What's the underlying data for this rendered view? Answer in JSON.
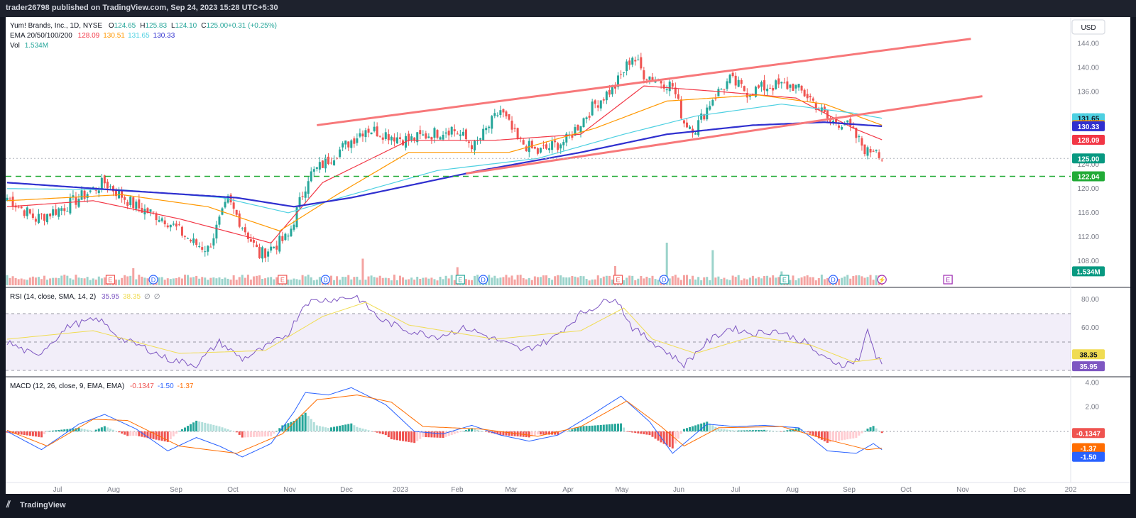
{
  "header": {
    "published": "trader26798 published on TradingView.com, Sep 24, 2023 15:28 UTC+5:30"
  },
  "footer": {
    "brand": "TradingView"
  },
  "colors": {
    "up": "#26a69a",
    "down": "#ef5350",
    "ema20": "#f23645",
    "ema50": "#ff9800",
    "ema100": "#4dd0e1",
    "ema200": "#2f2fcf",
    "trend": "#f7787a",
    "support": "#22ab37",
    "rsi": "#7e57c2",
    "rsi_ma": "#f0dc52",
    "macd": "#2962ff",
    "signal": "#ff6d00"
  },
  "currency_button": "USD",
  "legend": {
    "symbol": "Yum! Brands, Inc., 1D, NYSE",
    "ohlc": [
      {
        "key": "O",
        "value": "124.65"
      },
      {
        "key": "H",
        "value": "125.83"
      },
      {
        "key": "L",
        "value": "124.10"
      },
      {
        "key": "C",
        "value": "125.00"
      },
      {
        "key": "",
        "value": "+0.31 (+0.25%)"
      }
    ],
    "ema_label": "EMA 20/50/100/200",
    "ema_values": [
      "128.09",
      "130.51",
      "131.65",
      "130.33"
    ],
    "vol_label": "Vol",
    "vol_value": "1.534M",
    "rsi_label": "RSI (14, close, SMA, 14, 2)",
    "rsi_values": [
      "35.95",
      "38.35",
      "∅",
      "∅"
    ],
    "macd_label": "MACD (12, 26, close, 9, EMA, EMA)",
    "macd_values": [
      "-0.1347",
      "-1.50",
      "-1.37"
    ]
  },
  "chart_data": [
    {
      "type": "candlestick",
      "title": "Yum! Brands, Inc., 1D, NYSE",
      "ylim": [
        104,
        147
      ],
      "yticks": [
        "108.00",
        "112.00",
        "116.00",
        "120.00",
        "124.00",
        "128.00",
        "132.00",
        "136.00",
        "140.00",
        "144.00"
      ],
      "x_month_labels": [
        "Jul",
        "Aug",
        "Sep",
        "Oct",
        "Nov",
        "Dec",
        "2023",
        "Feb",
        "Mar",
        "Apr",
        "May",
        "Jun",
        "Jul",
        "Aug",
        "Sep",
        "Oct",
        "Nov",
        "Dec",
        "202"
      ],
      "close_anchors": [
        [
          0,
          118.5
        ],
        [
          10,
          115
        ],
        [
          20,
          117
        ],
        [
          34,
          121
        ],
        [
          45,
          117
        ],
        [
          55,
          115
        ],
        [
          65,
          111
        ],
        [
          70,
          110
        ],
        [
          77,
          118
        ],
        [
          88,
          109
        ],
        [
          98,
          112
        ],
        [
          105,
          122
        ],
        [
          115,
          126
        ],
        [
          125,
          130
        ],
        [
          140,
          128
        ],
        [
          155,
          130
        ],
        [
          163,
          127
        ],
        [
          172,
          133
        ],
        [
          178,
          128
        ],
        [
          185,
          126
        ],
        [
          195,
          128
        ],
        [
          205,
          134
        ],
        [
          212,
          137
        ],
        [
          218,
          142
        ],
        [
          222,
          139
        ],
        [
          232,
          137
        ],
        [
          236,
          131
        ],
        [
          240,
          130
        ],
        [
          246,
          135
        ],
        [
          252,
          138
        ],
        [
          258,
          136
        ],
        [
          266,
          137
        ],
        [
          274,
          137
        ],
        [
          280,
          135
        ],
        [
          287,
          131
        ],
        [
          292,
          131
        ],
        [
          300,
          126
        ],
        [
          303,
          127
        ],
        [
          305,
          125
        ]
      ],
      "ema_anchors": {
        "EMA 20": [
          [
            0,
            117
          ],
          [
            30,
            118
          ],
          [
            60,
            115
          ],
          [
            92,
            111
          ],
          [
            110,
            121
          ],
          [
            140,
            128
          ],
          [
            170,
            128
          ],
          [
            200,
            129
          ],
          [
            222,
            137
          ],
          [
            250,
            136
          ],
          [
            275,
            135
          ],
          [
            295,
            130
          ],
          [
            305,
            128.09
          ]
        ],
        "EMA 50": [
          [
            0,
            118
          ],
          [
            40,
            119
          ],
          [
            70,
            117
          ],
          [
            95,
            113
          ],
          [
            115,
            119
          ],
          [
            140,
            126
          ],
          [
            175,
            126
          ],
          [
            205,
            130
          ],
          [
            230,
            134.5
          ],
          [
            262,
            135.5
          ],
          [
            285,
            134
          ],
          [
            305,
            130.51
          ]
        ],
        "EMA 100": [
          [
            0,
            120
          ],
          [
            40,
            119.8
          ],
          [
            75,
            118.5
          ],
          [
            98,
            116
          ],
          [
            120,
            119
          ],
          [
            150,
            123
          ],
          [
            185,
            125
          ],
          [
            215,
            129
          ],
          [
            240,
            132
          ],
          [
            270,
            134
          ],
          [
            295,
            132.5
          ],
          [
            305,
            131.65
          ]
        ],
        "EMA 200": [
          [
            0,
            121
          ],
          [
            40,
            119.7
          ],
          [
            80,
            118.5
          ],
          [
            100,
            117
          ],
          [
            120,
            118.5
          ],
          [
            165,
            123
          ],
          [
            200,
            126
          ],
          [
            230,
            129
          ],
          [
            260,
            130.5
          ],
          [
            285,
            131
          ],
          [
            305,
            130.33
          ]
        ]
      },
      "trendlines": [
        {
          "from": [
            108,
            130.5
          ],
          "to": [
            336,
            144.8
          ]
        },
        {
          "from": [
            160,
            122.5
          ],
          "to": [
            340,
            135.3
          ]
        }
      ],
      "horizontal_lines": [
        {
          "value": 122.04,
          "style": "dashed"
        },
        {
          "value": 125.0,
          "style": "dotted"
        }
      ],
      "price_labels": [
        {
          "text": "131.65",
          "value": 131.65,
          "color": "#4dd0e1",
          "dark": true
        },
        {
          "text": "130.51",
          "value": 130.51,
          "color": "#ff9800",
          "dark": false
        },
        {
          "text": "130.33",
          "value": 130.33,
          "color": "#2f2fcf",
          "dark": false
        },
        {
          "text": "128.09",
          "value": 128.09,
          "color": "#f23645",
          "dark": false
        },
        {
          "text": "125.00",
          "value": 125.0,
          "color": "#089981",
          "dark": false
        },
        {
          "text": "122.04",
          "value": 122.04,
          "color": "#22ab37",
          "dark": false
        },
        {
          "text": "1.534M",
          "value": 106.3,
          "color": "#089981",
          "dark": false
        }
      ],
      "volume_spikes": [
        [
          44,
          1.6
        ],
        [
          124,
          2.5
        ],
        [
          157,
          1.7
        ],
        [
          212,
          1.8
        ],
        [
          230,
          4.0
        ],
        [
          246,
          3.3
        ],
        [
          270,
          1.3
        ]
      ],
      "event_markers": [
        {
          "index": 36,
          "label": "E",
          "color": "#ef5350"
        },
        {
          "index": 51,
          "label": "D",
          "color": "#2962ff"
        },
        {
          "index": 96,
          "label": "E",
          "color": "#ef5350"
        },
        {
          "index": 111,
          "label": "D",
          "color": "#2962ff"
        },
        {
          "index": 158,
          "label": "E",
          "color": "#26a69a"
        },
        {
          "index": 166,
          "label": "D",
          "color": "#2962ff"
        },
        {
          "index": 213,
          "label": "E",
          "color": "#ef5350"
        },
        {
          "index": 229,
          "label": "D",
          "color": "#2962ff"
        },
        {
          "index": 271,
          "label": "E",
          "color": "#26a69a"
        },
        {
          "index": 288,
          "label": "D",
          "color": "#2962ff"
        },
        {
          "index": 305,
          "label": "⚡",
          "color": "#9c27b0"
        },
        {
          "index": 328,
          "label": "E",
          "color": "#9c27b0"
        }
      ]
    },
    {
      "type": "line",
      "title": "RSI (14, close, SMA, 14, 2)",
      "ylim": [
        26,
        86
      ],
      "yticks": [
        "60.00",
        "80.00"
      ],
      "bands": [
        70,
        50,
        30
      ],
      "series": [
        {
          "name": "RSI",
          "anchors": [
            [
              0,
              50
            ],
            [
              10,
              40
            ],
            [
              22,
              62
            ],
            [
              32,
              66
            ],
            [
              40,
              52
            ],
            [
              48,
              46
            ],
            [
              56,
              38
            ],
            [
              66,
              34
            ],
            [
              74,
              50
            ],
            [
              82,
              38
            ],
            [
              90,
              46
            ],
            [
              98,
              56
            ],
            [
              104,
              78
            ],
            [
              112,
              80
            ],
            [
              122,
              82
            ],
            [
              130,
              66
            ],
            [
              140,
              58
            ],
            [
              150,
              54
            ],
            [
              160,
              60
            ],
            [
              170,
              52
            ],
            [
              180,
              44
            ],
            [
              190,
              52
            ],
            [
              200,
              70
            ],
            [
              212,
              82
            ],
            [
              218,
              60
            ],
            [
              228,
              46
            ],
            [
              236,
              34
            ],
            [
              244,
              50
            ],
            [
              252,
              60
            ],
            [
              260,
              56
            ],
            [
              268,
              58
            ],
            [
              278,
              50
            ],
            [
              285,
              38
            ],
            [
              292,
              34
            ],
            [
              297,
              38
            ],
            [
              300,
              58
            ],
            [
              303,
              40
            ],
            [
              305,
              35.95
            ]
          ],
          "last": "35.95"
        },
        {
          "name": "RSI-based MA",
          "anchors": [
            [
              0,
              52
            ],
            [
              30,
              58
            ],
            [
              60,
              42
            ],
            [
              90,
              44
            ],
            [
              110,
              68
            ],
            [
              125,
              78
            ],
            [
              140,
              62
            ],
            [
              170,
              52
            ],
            [
              200,
              58
            ],
            [
              215,
              74
            ],
            [
              225,
              52
            ],
            [
              240,
              42
            ],
            [
              260,
              54
            ],
            [
              280,
              48
            ],
            [
              295,
              36
            ],
            [
              305,
              38.35
            ]
          ],
          "last": "38.35"
        }
      ]
    },
    {
      "type": "line",
      "title": "MACD (12, 26, close, 9, EMA, EMA)",
      "ylim": [
        -4.2,
        4.2
      ],
      "yticks": [
        "2.00",
        "4.00"
      ],
      "series": [
        {
          "name": "MACD",
          "anchors": [
            [
              0,
              0
            ],
            [
              12,
              -1.5
            ],
            [
              25,
              0.6
            ],
            [
              34,
              1.4
            ],
            [
              45,
              0.2
            ],
            [
              56,
              -1.6
            ],
            [
              66,
              -0.5
            ],
            [
              74,
              -1.2
            ],
            [
              82,
              -2.1
            ],
            [
              92,
              -1.0
            ],
            [
              100,
              1.6
            ],
            [
              104,
              3.2
            ],
            [
              112,
              3.0
            ],
            [
              120,
              3.6
            ],
            [
              132,
              2.2
            ],
            [
              142,
              0.0
            ],
            [
              152,
              -0.2
            ],
            [
              162,
              0.5
            ],
            [
              172,
              -0.3
            ],
            [
              182,
              -0.8
            ],
            [
              192,
              -0.3
            ],
            [
              204,
              1.4
            ],
            [
              214,
              2.9
            ],
            [
              224,
              0.8
            ],
            [
              232,
              -1.8
            ],
            [
              244,
              0.6
            ],
            [
              254,
              0.4
            ],
            [
              264,
              0.5
            ],
            [
              276,
              0.3
            ],
            [
              286,
              -1.6
            ],
            [
              296,
              -1.8
            ],
            [
              302,
              -1.0
            ],
            [
              305,
              -1.5
            ]
          ],
          "last": "-1.50"
        },
        {
          "name": "Signal",
          "anchors": [
            [
              0,
              0.1
            ],
            [
              14,
              -1.2
            ],
            [
              30,
              1.0
            ],
            [
              42,
              0.9
            ],
            [
              60,
              -1.2
            ],
            [
              80,
              -1.8
            ],
            [
              96,
              -0.2
            ],
            [
              108,
              2.6
            ],
            [
              122,
              3.0
            ],
            [
              134,
              2.4
            ],
            [
              145,
              0.4
            ],
            [
              165,
              0.2
            ],
            [
              185,
              -0.4
            ],
            [
              200,
              0.4
            ],
            [
              216,
              2.5
            ],
            [
              228,
              0.4
            ],
            [
              236,
              -1.2
            ],
            [
              248,
              0.3
            ],
            [
              270,
              0.4
            ],
            [
              288,
              -0.8
            ],
            [
              300,
              -1.5
            ],
            [
              305,
              -1.37
            ]
          ],
          "last": "-1.37"
        }
      ],
      "hist_last": "-0.1347"
    }
  ]
}
